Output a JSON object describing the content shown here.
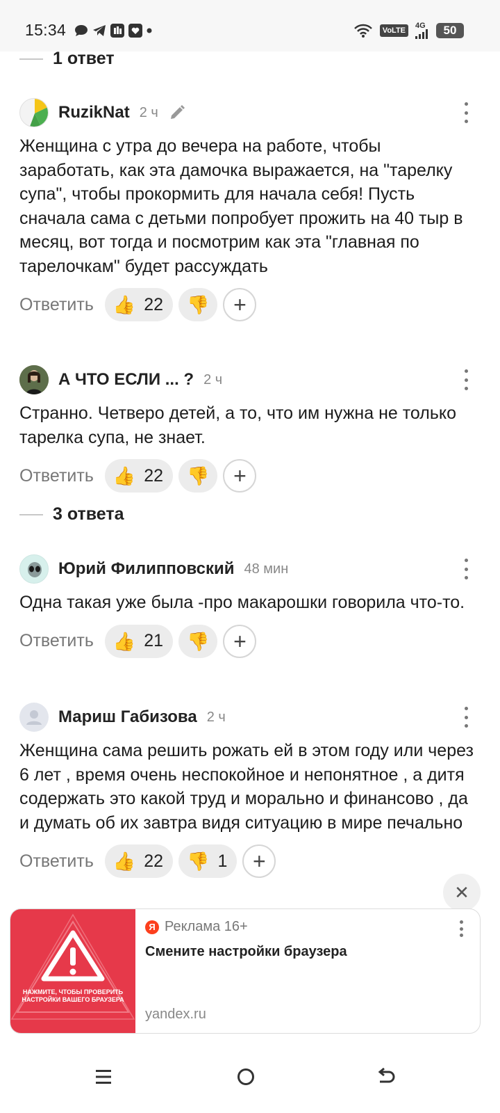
{
  "status_bar": {
    "time": "15:34",
    "left_icons": [
      "chat-icon",
      "telegram-icon",
      "app-icon",
      "gallery-icon",
      "dot-icon"
    ],
    "volte": "VoLTE",
    "network": "4G",
    "battery": "50"
  },
  "threads": {
    "first_label": "1 ответ",
    "second_label": "3 ответа"
  },
  "comments": [
    {
      "author": "RuzikNat",
      "time": "2 ч",
      "text": "Женщина с утра до вечера на работе, чтобы заработать, как эта дамочка выражается, на \"тарелку супа\", чтобы прокормить для начала себя! Пусть сначала сама с детьми попробует прожить на 40 тыр в месяц, вот тогда и посмотрим как эта \"главная по тарелочкам\" будет рассуждать",
      "reply": "Ответить",
      "likes": "22",
      "dislikes": ""
    },
    {
      "author": "А ЧТО ЕСЛИ ... ?",
      "time": "2 ч",
      "text": "Странно. Четверо детей, а то, что им нужна не только тарелка супа, не знает.",
      "reply": "Ответить",
      "likes": "22",
      "dislikes": ""
    },
    {
      "author": "Юрий Филипповский",
      "time": "48 мин",
      "text": "Одна такая уже была -про макарошки говорила что-то.",
      "reply": "Ответить",
      "likes": "21",
      "dislikes": ""
    },
    {
      "author": "Мариш Габизова",
      "time": "2 ч",
      "text": "Женщина сама решить рожать ей в этом году или через 6 лет , время очень неспокойное и непонятное , а дитя содержать это какой труд и морально и финансово , да и думать об их завтра видя ситуацию в мире печально",
      "reply": "Ответить",
      "likes": "22",
      "dislikes": "1"
    }
  ],
  "ad": {
    "label": "Реклама 16+",
    "logo": "Я",
    "title": "Смените настройки браузера",
    "domain": "yandex.ru",
    "image_text": "Нажмите, чтобы проверить настройки вашего браузера",
    "close": "✕"
  },
  "emoji": {
    "thumb_up": "👍",
    "thumb_down": "👎",
    "plus": "+"
  },
  "colors": {
    "accent_red": "#e6394a",
    "yandex_red": "#fc3f1d",
    "pill_bg": "#ececec"
  }
}
